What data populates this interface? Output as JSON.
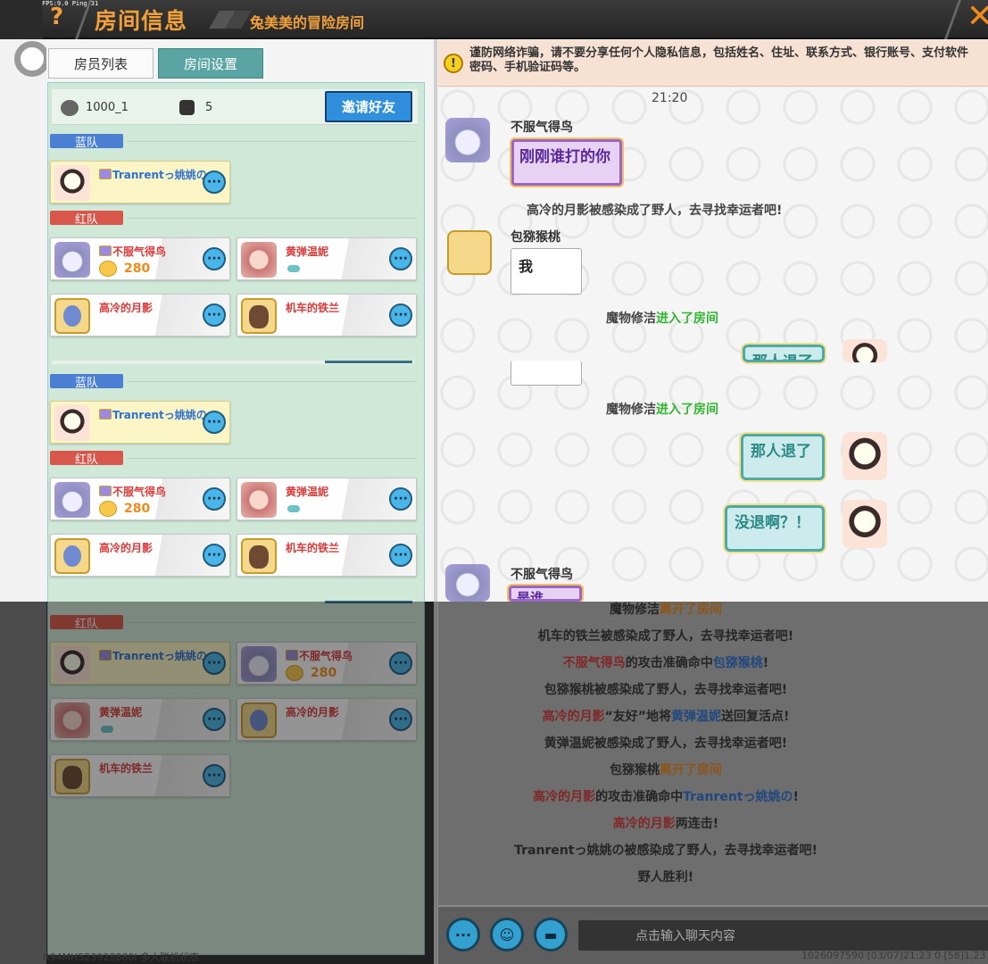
{
  "header": {
    "fps": "FPS:9.0  Ping:31",
    "help": "?",
    "title": "房间信息",
    "subtitle": "兔美美的冒险房间",
    "close": "✕"
  },
  "tabs": {
    "members": "房员列表",
    "settings": "房间设置"
  },
  "room": {
    "id": "1000_1",
    "count": "5",
    "invite": "邀请好友"
  },
  "teams": {
    "blue": "蓝队",
    "red": "红队"
  },
  "players": {
    "tranrent": "Tranrentっ姚姚の",
    "bufuqi": "不服气得鸟",
    "bufuqi_score": "280",
    "huangdan": "黄弹温妮",
    "gaoleng": "高冷的月影",
    "jiche": "机车的铁兰"
  },
  "more_glyph": "···",
  "warning": "谨防网络诈骗，请不要分享任何个人隐私信息，包括姓名、住址、联系方式、银行账号、支付软件密码、手机验证码等。",
  "chat": {
    "time": "21:20",
    "sender1": "不服气得鸟",
    "msg1": "刚刚谁打的你",
    "sys1": "高冷的月影被感染成了野人，去寻找幸运者吧!",
    "sender2": "包猕猴桃",
    "msg2": "我",
    "sys2_name": "魔物修洁",
    "sys2_action": "进入了房间",
    "msg3": "那人退了",
    "sys3_name": "魔物修洁",
    "sys3_action": "进入了房间",
    "msg4": "那人退了",
    "msg5": "没退啊？！",
    "sender3": "不服气得鸟",
    "msg6": "是谁"
  },
  "log": {
    "l1_name": "魔物修洁",
    "l1_action": "离开了房间",
    "l2": "机车的铁兰被感染成了野人，去寻找幸运者吧!",
    "l3_a": "不服气得鸟",
    "l3_b": "的攻击准确命中",
    "l3_c": "包猕猴桃",
    "l3_d": "!",
    "l4": "包猕猴桃被感染成了野人，去寻找幸运者吧!",
    "l5_a": "高冷的月影",
    "l5_b": "“友好”地将",
    "l5_c": "黄弹温妮",
    "l5_d": "送回复活点!",
    "l6": "黄弹温妮被感染成了野人，去寻找幸运者吧!",
    "l7_name": "包猕猴桃",
    "l7_action": "离开了房间",
    "l8_a": "高冷的月影",
    "l8_b": "的攻击准确命中",
    "l8_c": "Tranrentっ姚姚の",
    "l8_d": "!",
    "l9_a": "高冷的月影",
    "l9_b": "两连击!",
    "l10": "Tranrentっ姚姚の被感染成了野人，去寻找幸运者吧!",
    "l11": "野人胜利!"
  },
  "input": {
    "placeholder": "点击输入聊天内容"
  },
  "footer": {
    "left": "R94MH523928880I 多人联机状态",
    "right": "1026097590   [03/07]21:23 0   [58]1.23"
  }
}
